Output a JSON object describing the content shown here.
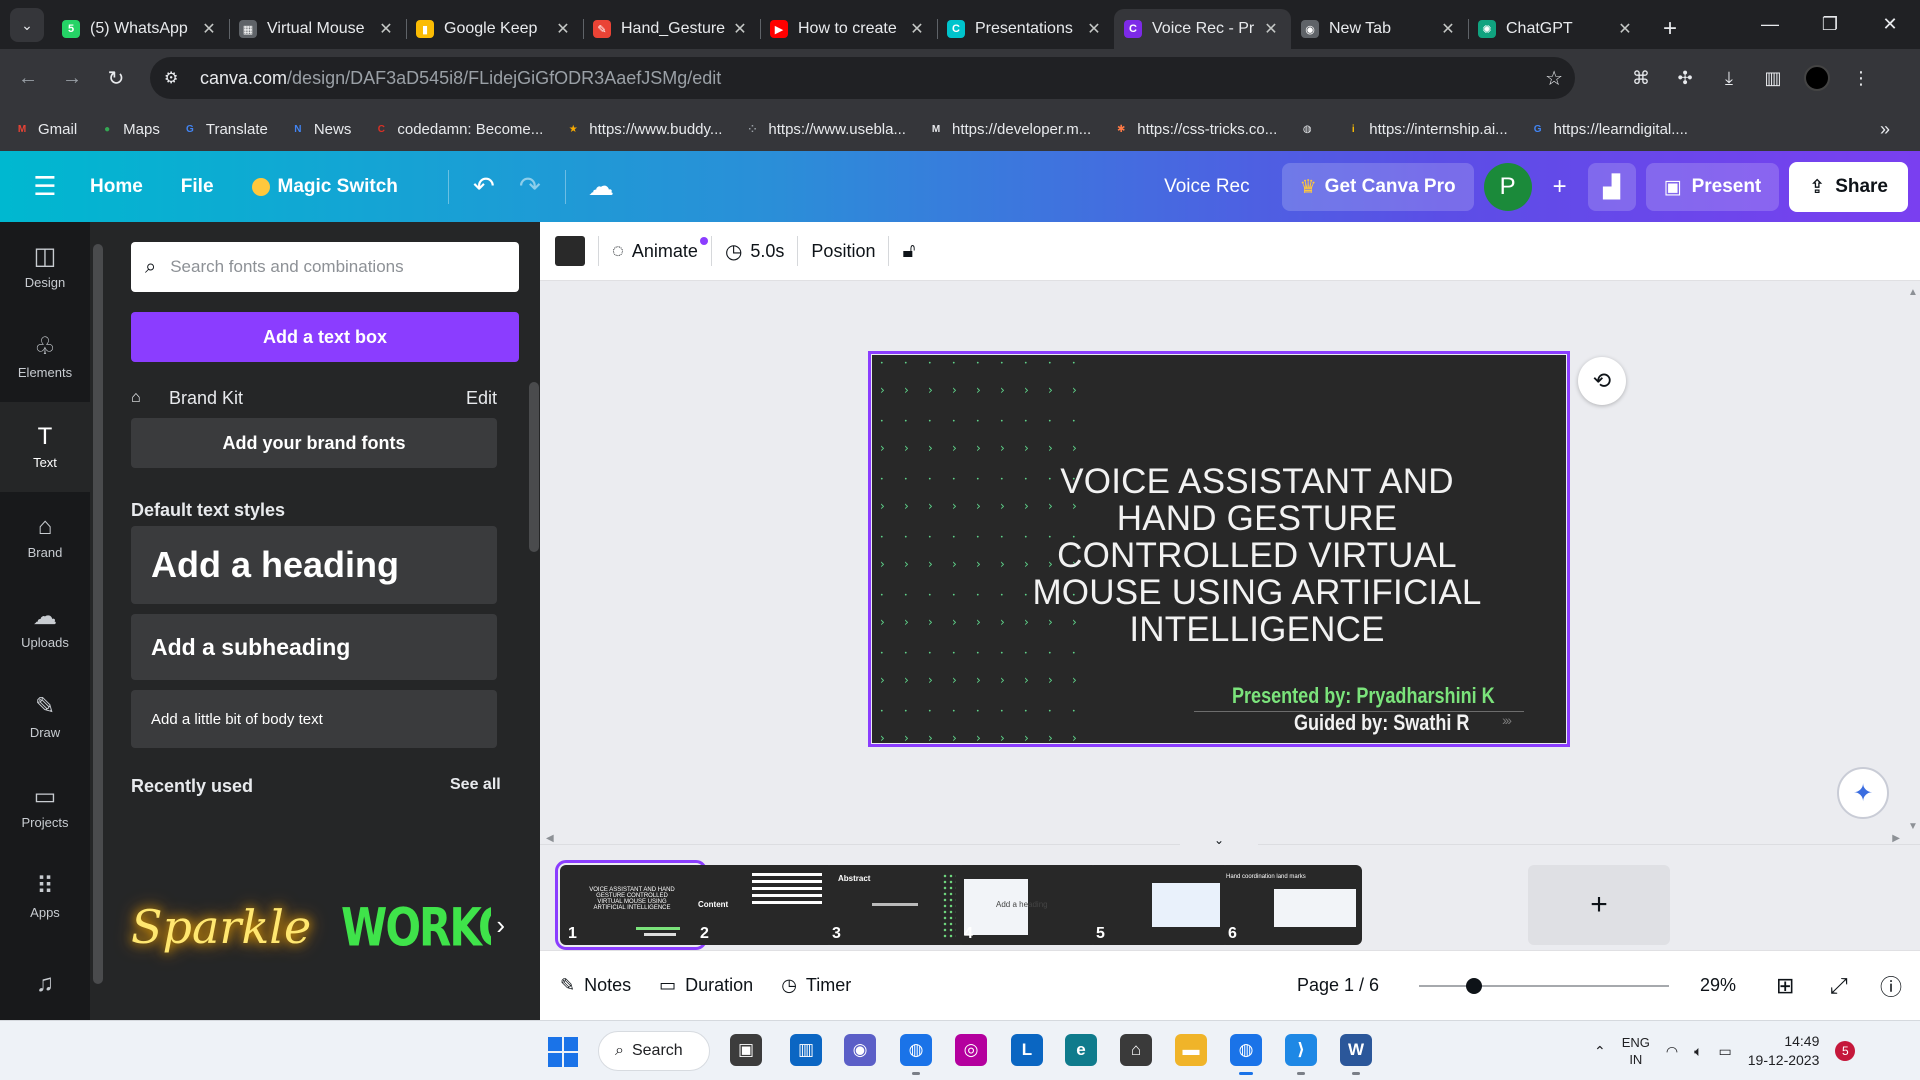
{
  "browser": {
    "tabs": [
      {
        "title": "(5) WhatsApp",
        "favicon": "whatsapp-icon",
        "color": "#25d366",
        "glyph": "5"
      },
      {
        "title": "Virtual Mouse",
        "favicon": "doc-icon",
        "color": "#5f6368",
        "glyph": "▦"
      },
      {
        "title": "Google Keep",
        "favicon": "keep-icon",
        "color": "#fbbc04",
        "glyph": "▮"
      },
      {
        "title": "Hand_Gesture",
        "favicon": "file-icon",
        "color": "#ea4335",
        "glyph": "✎"
      },
      {
        "title": "How to create",
        "favicon": "youtube-icon",
        "color": "#ff0000",
        "glyph": "▶"
      },
      {
        "title": "Presentations",
        "favicon": "canva-icon",
        "color": "#00c4cc",
        "glyph": "C"
      },
      {
        "title": "Voice Rec - Pr",
        "favicon": "canva-icon",
        "color": "#7d2ae8",
        "glyph": "C",
        "active": true
      },
      {
        "title": "New Tab",
        "favicon": "chrome-icon",
        "color": "#5f6368",
        "glyph": "◉"
      },
      {
        "title": "ChatGPT",
        "favicon": "chatgpt-icon",
        "color": "#10a37f",
        "glyph": "✺"
      }
    ],
    "url_host": "canva.com",
    "url_path": "/design/DAF3aD545i8/FLidejGiGfODR3AaefJSMg/edit",
    "bookmarks": [
      {
        "label": "Gmail",
        "icon": "gmail-icon",
        "color": "#ea4335",
        "glyph": "M"
      },
      {
        "label": "Maps",
        "icon": "maps-icon",
        "color": "#34a853",
        "glyph": "●"
      },
      {
        "label": "Translate",
        "icon": "translate-icon",
        "color": "#4285f4",
        "glyph": "G"
      },
      {
        "label": "News",
        "icon": "news-icon",
        "color": "#4285f4",
        "glyph": "N"
      },
      {
        "label": "codedamn: Become...",
        "icon": "codedamn-icon",
        "color": "#d93025",
        "glyph": "C"
      },
      {
        "label": "https://www.buddy...",
        "icon": "star-icon",
        "color": "#f9ab00",
        "glyph": "★"
      },
      {
        "label": "https://www.usebla...",
        "icon": "dots-icon",
        "color": "#9aa0a6",
        "glyph": "⁘"
      },
      {
        "label": "https://developer.m...",
        "icon": "mdn-icon",
        "color": "#e8eaed",
        "glyph": "M"
      },
      {
        "label": "https://css-tricks.co...",
        "icon": "css-tricks-icon",
        "color": "#ff7a45",
        "glyph": "✱"
      },
      {
        "label": "",
        "icon": "globe-icon",
        "color": "#e8eaed",
        "glyph": "◍"
      },
      {
        "label": "https://internship.ai...",
        "icon": "internship-icon",
        "color": "#fbbc04",
        "glyph": "i"
      },
      {
        "label": "https://learndigital....",
        "icon": "google-icon",
        "color": "#4285f4",
        "glyph": "G"
      }
    ]
  },
  "canva": {
    "menu": {
      "home": "Home",
      "file": "File",
      "magic_switch": "Magic Switch"
    },
    "doc_name": "Voice Rec",
    "get_pro": "Get Canva Pro",
    "avatar_letter": "P",
    "present": "Present",
    "share": "Share",
    "rail": [
      {
        "label": "Design",
        "icon": "design-icon",
        "glyph": "◫"
      },
      {
        "label": "Elements",
        "icon": "elements-icon",
        "glyph": "♧"
      },
      {
        "label": "Text",
        "icon": "text-icon",
        "glyph": "T",
        "active": true
      },
      {
        "label": "Brand",
        "icon": "brand-icon",
        "glyph": "⌂"
      },
      {
        "label": "Uploads",
        "icon": "upload-icon",
        "glyph": "☁"
      },
      {
        "label": "Draw",
        "icon": "draw-icon",
        "glyph": "✎"
      },
      {
        "label": "Projects",
        "icon": "folder-icon",
        "glyph": "▭"
      },
      {
        "label": "Apps",
        "icon": "apps-icon",
        "glyph": "⠿"
      },
      {
        "label": "",
        "icon": "music-icon",
        "glyph": "♫"
      }
    ],
    "panel": {
      "search_placeholder": "Search fonts and combinations",
      "add_text_box": "Add a text box",
      "brand_kit": "Brand Kit",
      "edit": "Edit",
      "add_brand_fonts": "Add your brand fonts",
      "default_styles": "Default text styles",
      "heading": "Add a heading",
      "subheading": "Add a subheading",
      "body": "Add a little bit of body text",
      "recently_used": "Recently used",
      "see_all": "See all",
      "recent_items": [
        "Sparkle",
        "WORKOUT"
      ]
    },
    "toolbar": {
      "animate": "Animate",
      "duration": "5.0s",
      "position": "Position",
      "swatch_color": "#292929"
    },
    "slide": {
      "title": "VOICE ASSISTANT AND HAND GESTURE CONTROLLED VIRTUAL MOUSE USING ARTIFICIAL INTELLIGENCE",
      "presented_by": "Presented by: Pryadharshini K",
      "guided_by": "Guided by: Swathi R",
      "accent": "#7be37b"
    },
    "thumbnails": [
      {
        "num": "1",
        "text": "VOICE ASSISTANT AND HAND GESTURE CONTROLLED VIRTUAL MOUSE USING ARTIFICIAL INTELLIGENCE"
      },
      {
        "num": "2",
        "text": "Content"
      },
      {
        "num": "3",
        "text": "Abstract"
      },
      {
        "num": "4",
        "text": "Add a heading"
      },
      {
        "num": "5",
        "text": ""
      },
      {
        "num": "6",
        "text": "Hand coordination land marks"
      }
    ],
    "footer": {
      "notes": "Notes",
      "duration": "Duration",
      "timer": "Timer",
      "page": "Page 1 / 6",
      "zoom": "29%",
      "zoom_fraction": 0.22
    }
  },
  "taskbar": {
    "search": "Search",
    "lang_1": "ENG",
    "lang_2": "IN",
    "time": "14:49",
    "date": "19-12-2023",
    "notifications": "5"
  }
}
